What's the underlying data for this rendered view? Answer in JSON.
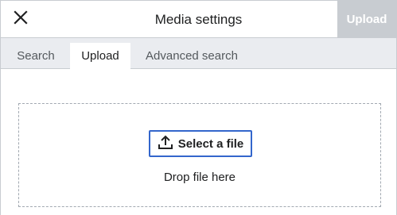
{
  "header": {
    "title": "Media settings",
    "close_icon": "close-icon",
    "primary_action": "Upload"
  },
  "tabs": [
    {
      "label": "Search",
      "selected": false
    },
    {
      "label": "Upload",
      "selected": true
    },
    {
      "label": "Advanced search",
      "selected": false
    }
  ],
  "upload_panel": {
    "select_button_label": "Select a file",
    "select_button_icon": "upload-icon",
    "drop_text": "Drop file here"
  },
  "colors": {
    "accent": "#3366cc",
    "disabled_button": "#c8ccd1",
    "tab_bar": "#eaecf0"
  }
}
